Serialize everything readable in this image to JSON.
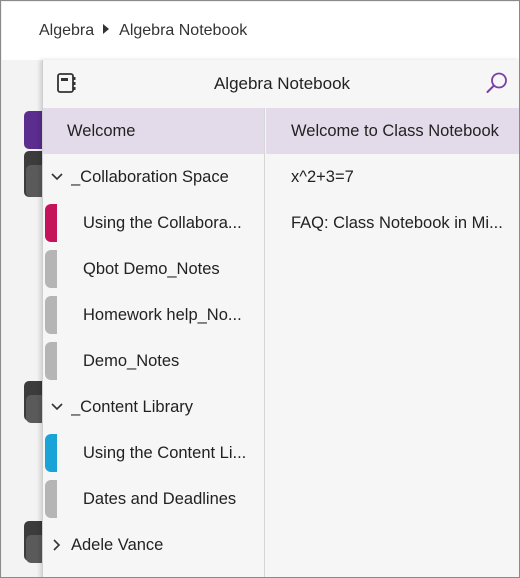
{
  "breadcrumb": {
    "root": "Algebra",
    "current": "Algebra Notebook"
  },
  "panel": {
    "title": "Algebra Notebook",
    "icons": {
      "notebook": "notebook-icon",
      "search": "search-icon"
    },
    "accent_color": "#7a3fa8"
  },
  "sections": [
    {
      "label": "Welcome",
      "type": "section",
      "selected": true
    },
    {
      "label": "_Collaboration Space",
      "type": "group",
      "expanded": true
    },
    {
      "label": "Using the Collabora...",
      "type": "section",
      "tab_color": "#c4135b"
    },
    {
      "label": "Qbot Demo_Notes",
      "type": "section",
      "tab_color": "#b5b5b5"
    },
    {
      "label": "Homework help_No...",
      "type": "section",
      "tab_color": "#b5b5b5"
    },
    {
      "label": "Demo_Notes",
      "type": "section",
      "tab_color": "#b5b5b5"
    },
    {
      "label": "_Content Library",
      "type": "group",
      "expanded": true
    },
    {
      "label": "Using the Content Li...",
      "type": "section",
      "tab_color": "#1aa3d6"
    },
    {
      "label": "Dates and Deadlines",
      "type": "section",
      "tab_color": "#b5b5b5"
    },
    {
      "label": "Adele Vance",
      "type": "group",
      "expanded": false
    }
  ],
  "pages": [
    {
      "label": "Welcome to Class Notebook",
      "selected": true
    },
    {
      "label": "x^2+3=7"
    },
    {
      "label": "FAQ: Class Notebook in Mi..."
    }
  ]
}
